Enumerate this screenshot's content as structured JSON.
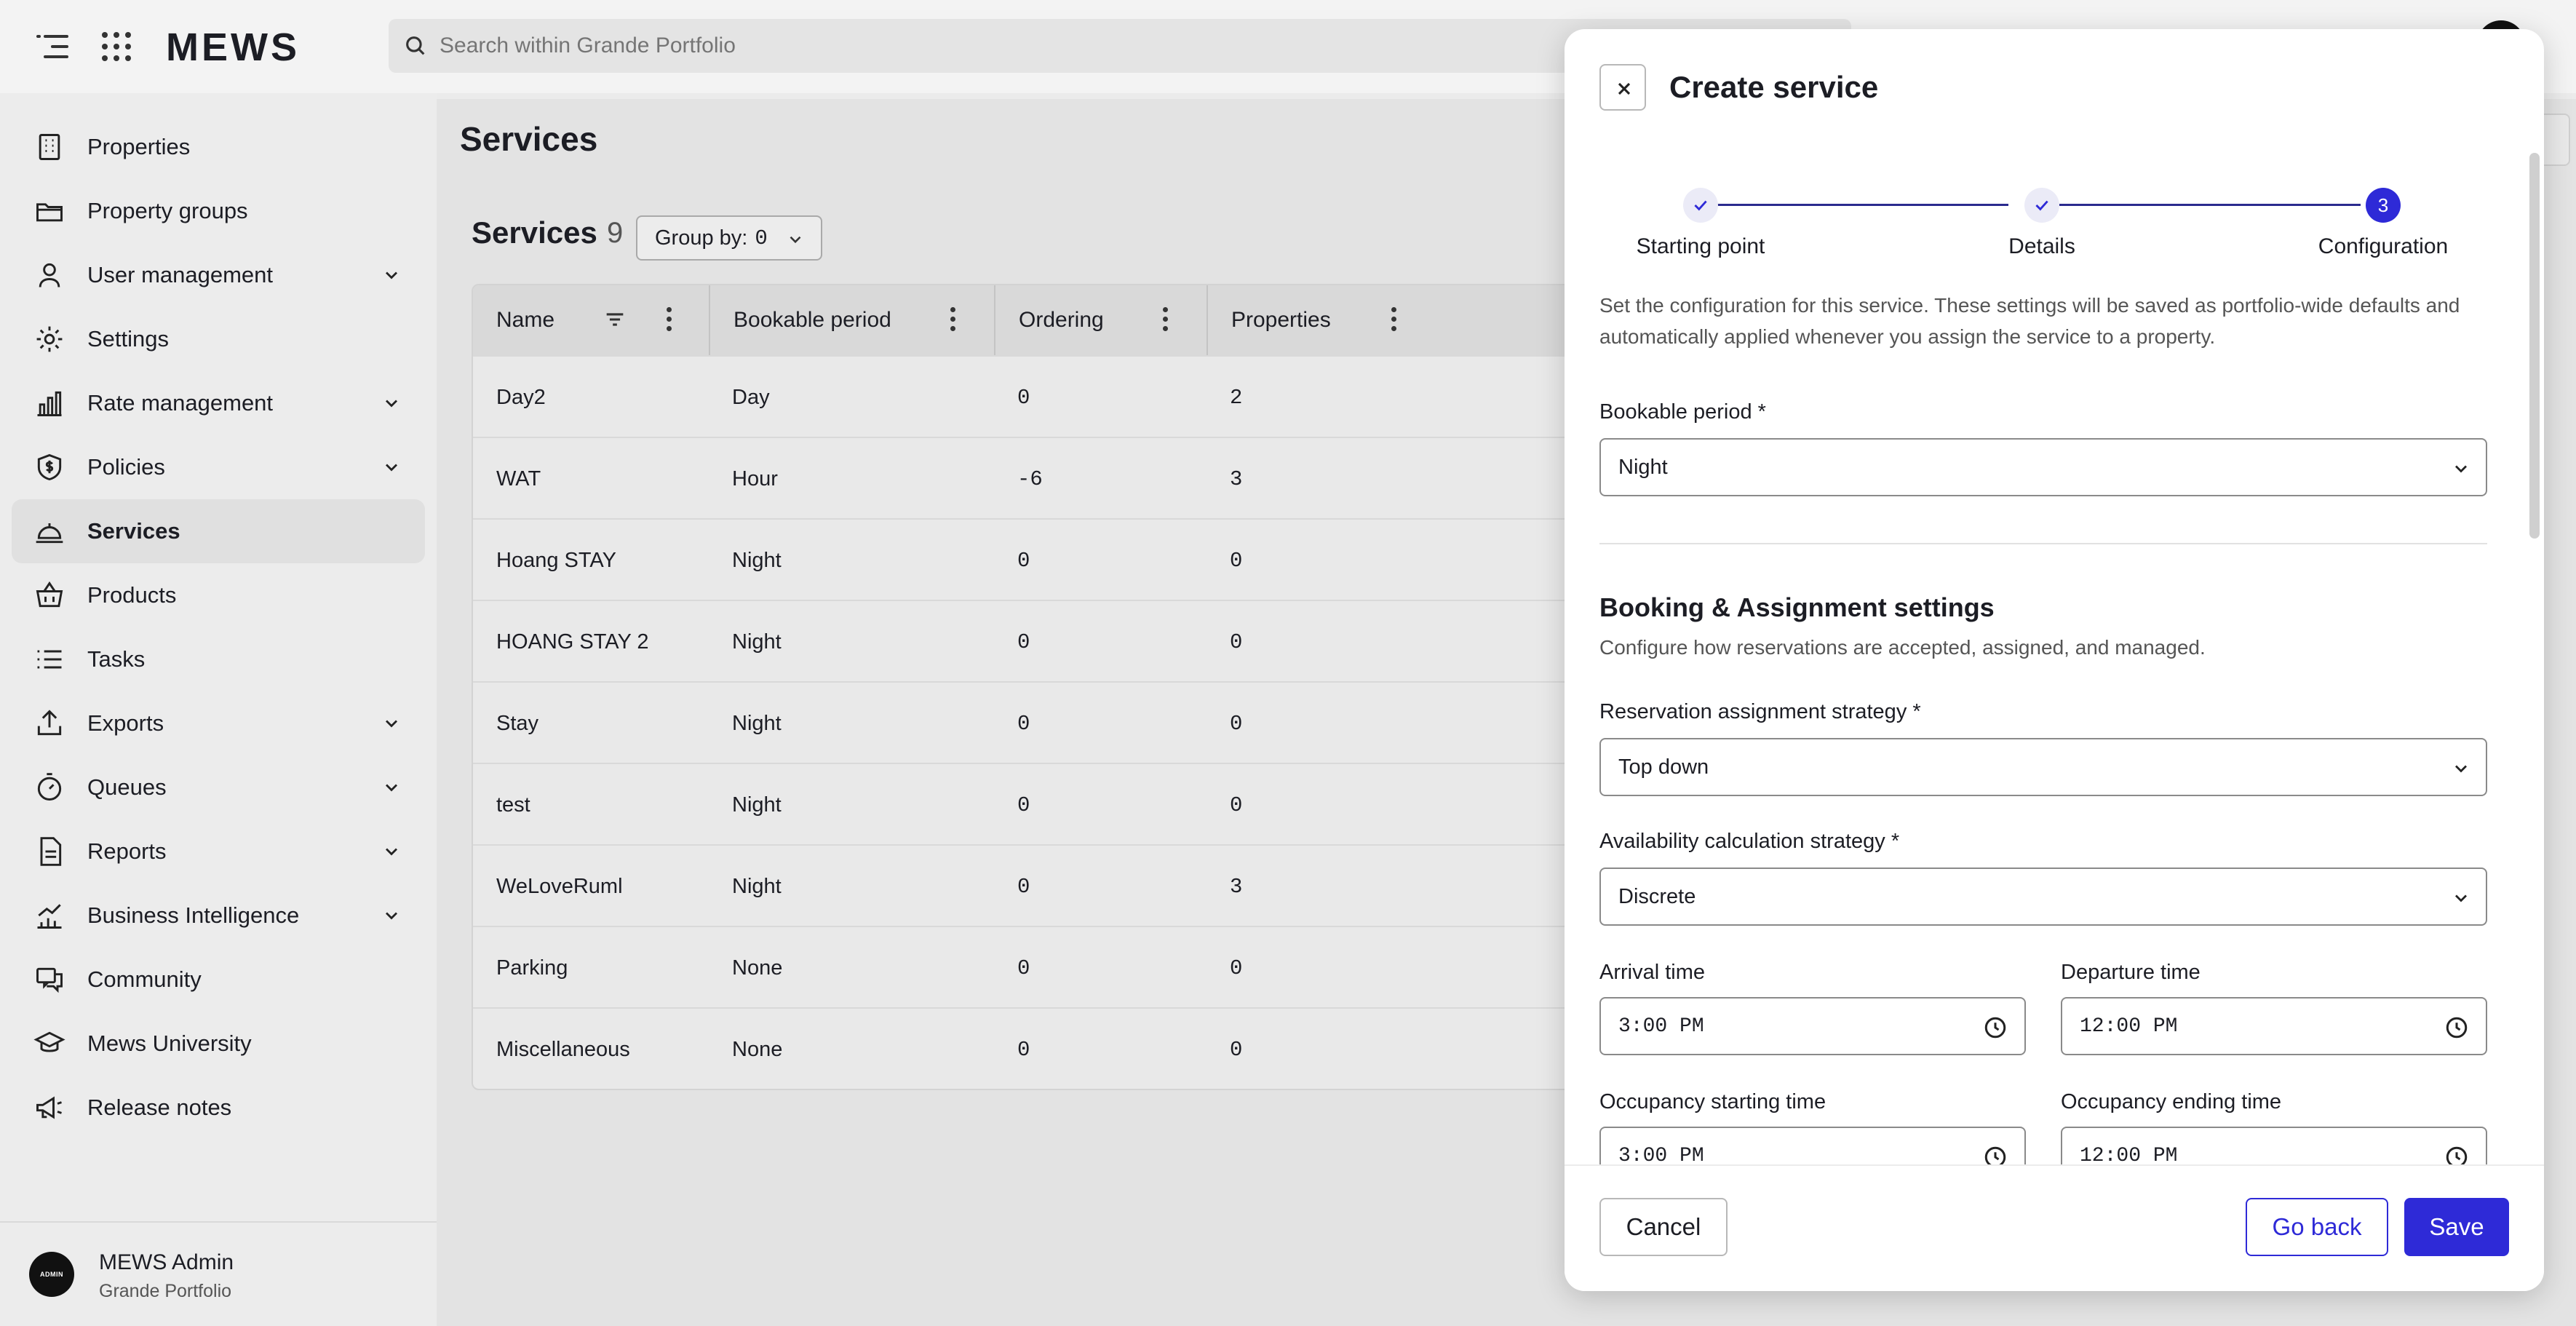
{
  "app": {
    "logo": "MEWS"
  },
  "search": {
    "placeholder": "Search within Grande Portfolio"
  },
  "sidebar": {
    "items": [
      {
        "label": "Properties",
        "icon": "building-icon",
        "expandable": false,
        "active": false
      },
      {
        "label": "Property groups",
        "icon": "folder-icon",
        "expandable": false,
        "active": false
      },
      {
        "label": "User management",
        "icon": "user-icon",
        "expandable": true,
        "active": false
      },
      {
        "label": "Settings",
        "icon": "gear-icon",
        "expandable": false,
        "active": false
      },
      {
        "label": "Rate management",
        "icon": "bar-chart-icon",
        "expandable": true,
        "active": false
      },
      {
        "label": "Policies",
        "icon": "shield-dollar-icon",
        "expandable": true,
        "active": false
      },
      {
        "label": "Services",
        "icon": "service-bell-icon",
        "expandable": false,
        "active": true
      },
      {
        "label": "Products",
        "icon": "basket-icon",
        "expandable": false,
        "active": false
      },
      {
        "label": "Tasks",
        "icon": "list-icon",
        "expandable": false,
        "active": false
      },
      {
        "label": "Exports",
        "icon": "export-icon",
        "expandable": true,
        "active": false
      },
      {
        "label": "Queues",
        "icon": "stopwatch-icon",
        "expandable": true,
        "active": false
      },
      {
        "label": "Reports",
        "icon": "report-icon",
        "expandable": true,
        "active": false
      },
      {
        "label": "Business Intelligence",
        "icon": "trend-chart-icon",
        "expandable": true,
        "active": false
      },
      {
        "label": "Community",
        "icon": "chat-icon",
        "expandable": false,
        "active": false
      },
      {
        "label": "Mews University",
        "icon": "graduation-cap-icon",
        "expandable": false,
        "active": false
      },
      {
        "label": "Release notes",
        "icon": "megaphone-icon",
        "expandable": false,
        "active": false
      }
    ],
    "user": {
      "avatar_text": "ADMIN",
      "name": "MEWS Admin",
      "org": "Grande Portfolio"
    }
  },
  "main": {
    "page_title": "Services",
    "section_title": "Services",
    "count": "9",
    "group_by_label": "Group by:",
    "group_by_value": "0",
    "columns": [
      "Name",
      "Bookable period",
      "Ordering",
      "Properties"
    ],
    "rows": [
      [
        "Day2",
        "Day",
        "0",
        "2"
      ],
      [
        "WAT",
        "Hour",
        "-6",
        "3"
      ],
      [
        "Hoang STAY",
        "Night",
        "0",
        "0"
      ],
      [
        "HOANG STAY 2",
        "Night",
        "0",
        "0"
      ],
      [
        "Stay",
        "Night",
        "0",
        "0"
      ],
      [
        "test",
        "Night",
        "0",
        "0"
      ],
      [
        "WeLoveRuml",
        "Night",
        "0",
        "3"
      ],
      [
        "Parking",
        "None",
        "0",
        "0"
      ],
      [
        "Miscellaneous",
        "None",
        "0",
        "0"
      ]
    ]
  },
  "modal": {
    "title": "Create service",
    "steps": [
      {
        "label": "Starting point",
        "state": "done",
        "marker": ""
      },
      {
        "label": "Details",
        "state": "done",
        "marker": ""
      },
      {
        "label": "Configuration",
        "state": "current",
        "marker": "3"
      }
    ],
    "intro": "Set the configuration for this service. These settings will be saved as portfolio-wide defaults and automatically applied whenever you assign the service to a property.",
    "bookable_period": {
      "label": "Bookable period *",
      "value": "Night"
    },
    "section": {
      "title": "Booking & Assignment settings",
      "subtitle": "Configure how reservations are accepted, assigned, and managed."
    },
    "assignment_strategy": {
      "label": "Reservation assignment strategy *",
      "value": "Top down"
    },
    "availability_strategy": {
      "label": "Availability calculation strategy *",
      "value": "Discrete"
    },
    "arrival_time": {
      "label": "Arrival time",
      "value": "3:00 PM"
    },
    "departure_time": {
      "label": "Departure time",
      "value": "12:00 PM"
    },
    "occupancy_start": {
      "label": "Occupancy starting time",
      "value": "3:00 PM"
    },
    "occupancy_end": {
      "label": "Occupancy ending time",
      "value": "12:00 PM"
    },
    "buttons": {
      "cancel": "Cancel",
      "go_back": "Go back",
      "save": "Save"
    }
  },
  "colors": {
    "accent": "#2e2ad7",
    "stepper_line": "#2b2b8e"
  }
}
